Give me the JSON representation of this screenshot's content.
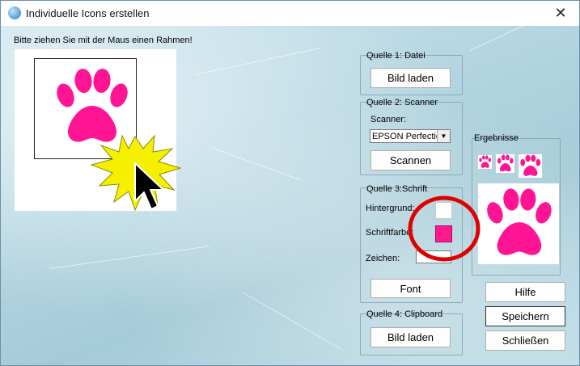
{
  "window": {
    "title": "Individuelle Icons erstellen",
    "close_glyph": "✕"
  },
  "capture": {
    "instruction": "Bitte ziehen Sie mit der Maus einen Rahmen!"
  },
  "source1": {
    "label": "Quelle 1: Datei",
    "load_button": "Bild laden"
  },
  "source2": {
    "label": "Quelle 2: Scanner",
    "scanner_label": "Scanner:",
    "scanner_value": "EPSON Perfectio",
    "scan_button": "Scannen"
  },
  "source3": {
    "label": "Quelle 3:Schrift",
    "background_label": "Hintergrund:",
    "background_color": "#ffffff",
    "fontcolor_label": "Schriftfarbe:",
    "font_color": "#ff1a8c",
    "char_label": "Zeichen:",
    "char_value": "",
    "font_button": "Font"
  },
  "source4": {
    "label": "Quelle 4: Clipboard",
    "load_button": "Bild laden"
  },
  "results": {
    "label": "Ergebnisse"
  },
  "actions": {
    "help": "Hilfe",
    "save": "Speichern",
    "close": "Schließen"
  },
  "colors": {
    "paw": "#ff1493",
    "highlight_circle": "#e00000",
    "burst": "#f5f000"
  },
  "icons": {
    "app": "app-icon",
    "paw": "paw-print-icon",
    "cursor": "mouse-pointer-icon",
    "burst": "click-burst-icon"
  }
}
